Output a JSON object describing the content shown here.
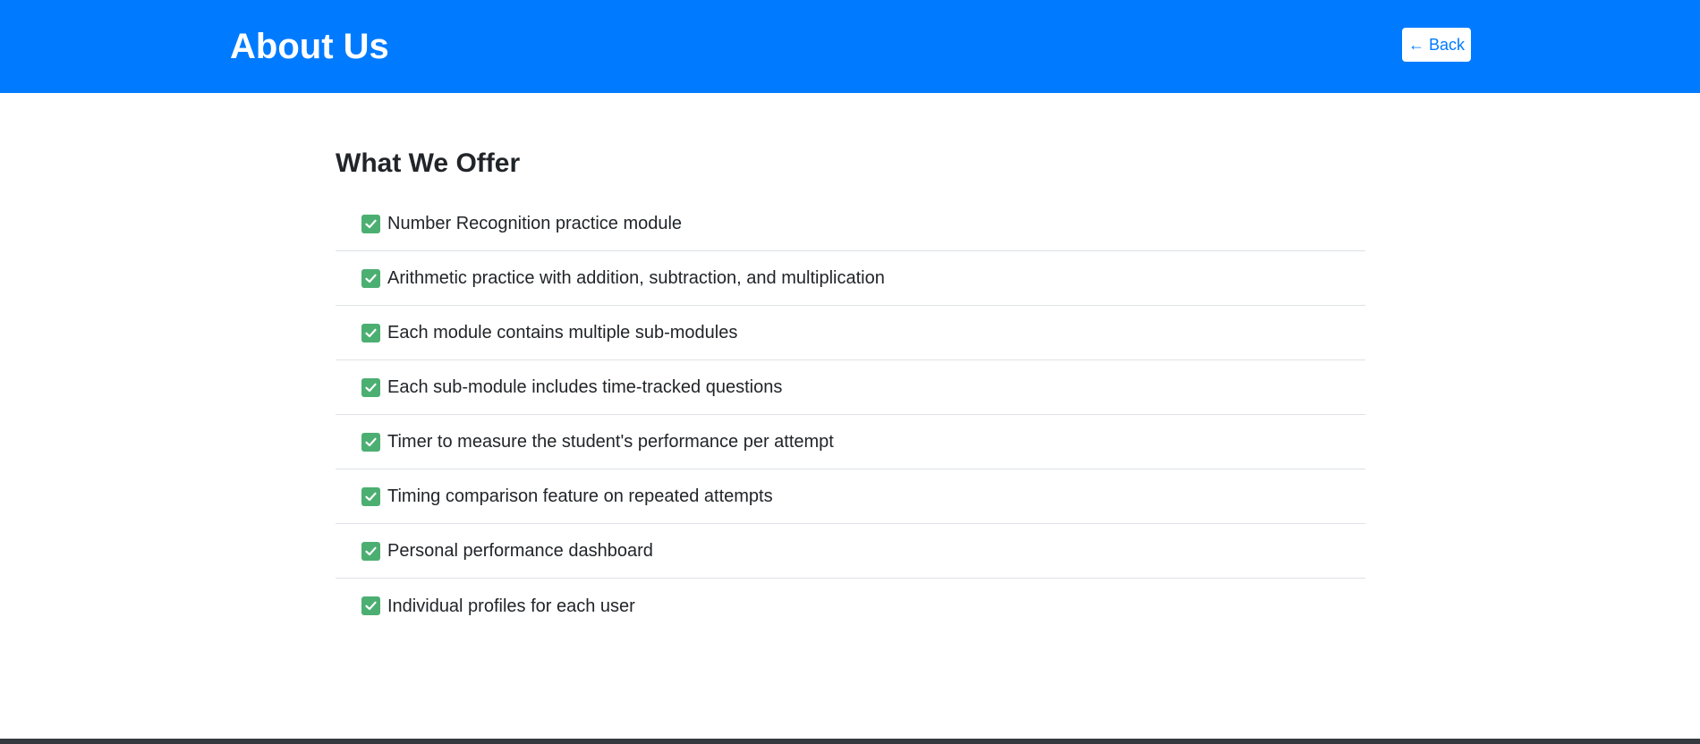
{
  "header": {
    "title": "About Us",
    "back_label": "← Back"
  },
  "main": {
    "section_title": "What We Offer",
    "features": [
      "Number Recognition practice module",
      "Arithmetic practice with addition, subtraction, and multiplication",
      "Each module contains multiple sub-modules",
      "Each sub-module includes time-tracked questions",
      "Timer to measure the student's performance per attempt",
      "Timing comparison feature on repeated attempts",
      "Personal performance dashboard",
      "Individual profiles for each user"
    ]
  },
  "icons": {
    "feature_icon": "check-mark-button-icon"
  },
  "colors": {
    "header_background": "#007bff",
    "check_icon": "#4caf72",
    "footer": "#343a40"
  }
}
